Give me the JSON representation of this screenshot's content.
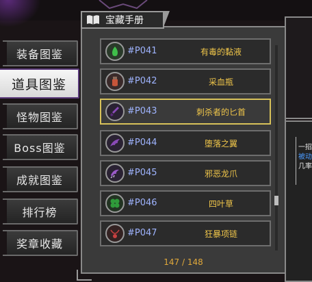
{
  "panel_title": "宝藏手册",
  "nav": [
    {
      "label": "装备图鉴",
      "active": false
    },
    {
      "label": "道具图鉴",
      "active": true
    },
    {
      "label": "怪物图鉴",
      "active": false
    },
    {
      "label": "Boss图鉴",
      "active": false
    },
    {
      "label": "成就图鉴",
      "active": false
    },
    {
      "label": "排行榜",
      "active": false
    },
    {
      "label": "奖章收藏",
      "active": false
    }
  ],
  "items": [
    {
      "code": "#P041",
      "name": "有毒的黏液",
      "icon": "poison-slime-icon",
      "color": "#3fbf4a",
      "selected": false
    },
    {
      "code": "#P042",
      "name": "采血瓶",
      "icon": "blood-vial-icon",
      "color": "#c8553a",
      "selected": false
    },
    {
      "code": "#P043",
      "name": "刺杀者的匕首",
      "icon": "assassin-dagger-icon",
      "color": "#8a4ab8",
      "selected": true
    },
    {
      "code": "#P044",
      "name": "堕落之翼",
      "icon": "fallen-wing-icon",
      "color": "#8a4ab8",
      "selected": false
    },
    {
      "code": "#P045",
      "name": "邪恶龙爪",
      "icon": "dragon-claw-icon",
      "color": "#9a5ac8",
      "selected": false
    },
    {
      "code": "#P046",
      "name": "四叶草",
      "icon": "clover-icon",
      "color": "#2f9a3a",
      "selected": false
    },
    {
      "code": "#P047",
      "name": "狂暴项链",
      "icon": "necklace-icon",
      "color": "#c84040",
      "selected": false
    }
  ],
  "count": "147 / 148",
  "detail": {
    "line1": "一招",
    "line2": "被动",
    "line3": "几率"
  },
  "colors": {
    "code": "#9fb4ff",
    "name": "#f0c64a",
    "selected_border": "#d8c25a",
    "detail_blue": "#4a9aff"
  }
}
